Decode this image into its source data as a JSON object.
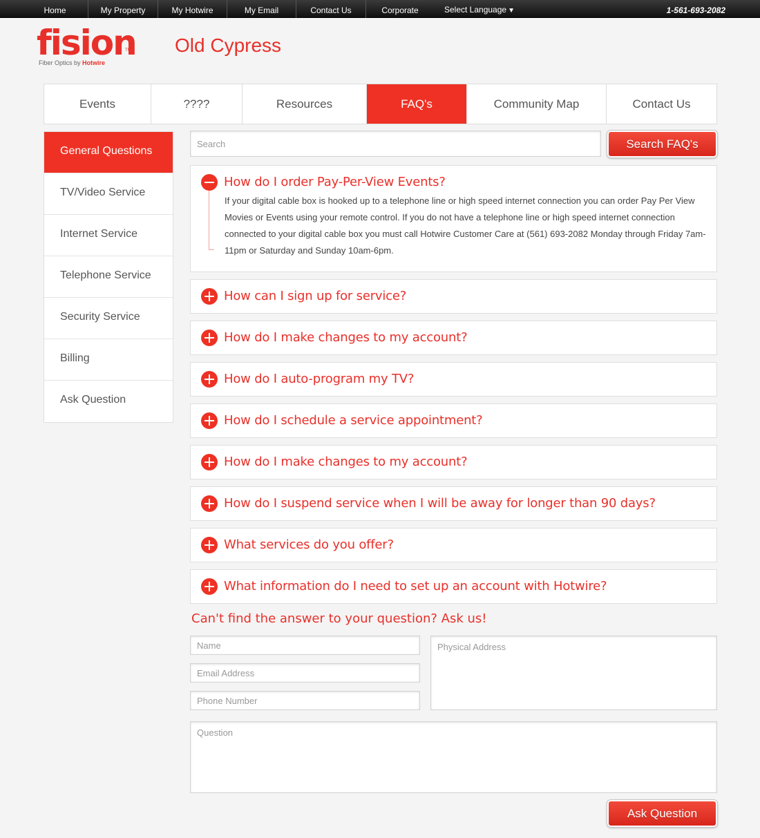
{
  "topnav": {
    "items": [
      "Home",
      "My Property",
      "My Hotwire",
      "My Email",
      "Contact Us",
      "Corporate"
    ],
    "language": "Select Language",
    "phone": "1-561-693-2082"
  },
  "header": {
    "logo_text": "fision",
    "logo_tagline": "Fiber Optics by",
    "logo_brand": "Hotwire",
    "property_name": "Old Cypress"
  },
  "tabs": [
    "Events",
    "????",
    "Resources",
    "FAQ's",
    "Community Map",
    "Contact Us"
  ],
  "active_tab": "FAQ's",
  "sidebar": {
    "items": [
      "General Questions",
      "TV/Video Service",
      "Internet Service",
      "Telephone Service",
      "Security Service",
      "Billing",
      "Ask Question"
    ]
  },
  "search": {
    "placeholder": "Search",
    "button_label": "Search FAQ's"
  },
  "faq": {
    "open_question": "How do I order Pay-Per-View Events?",
    "open_answer": "If your digital cable box is hooked up to a telephone line or high speed internet connection you can order Pay Per View Movies or Events using your remote control. If you do not have a telephone line or high speed internet connection connected to your digital cable box you must call Hotwire Customer Care at (561) 693-2082 Monday through Friday 7am-11pm or Saturday and Sunday 10am-6pm.",
    "questions": [
      "How can I sign up for service?",
      "How do I make changes to my account?",
      "How do I auto-program my TV?",
      "How do I schedule a service appointment?",
      "How do I make changes to my account?",
      "How do I suspend service when I will be away for longer than 90 days?",
      "What services do you offer?",
      "What information do I need to set up an account with Hotwire?"
    ]
  },
  "ask_form": {
    "heading": "Can't find the answer to your question? Ask us!",
    "name_placeholder": "Name",
    "email_placeholder": "Email Address",
    "phone_placeholder": "Phone Number",
    "address_placeholder": "Physical Address",
    "question_placeholder": "Question",
    "submit_label": "Ask Question"
  },
  "colors": {
    "accent": "#ee3124",
    "topbar": "#1a1a1a",
    "background": "#f4f4f4"
  }
}
